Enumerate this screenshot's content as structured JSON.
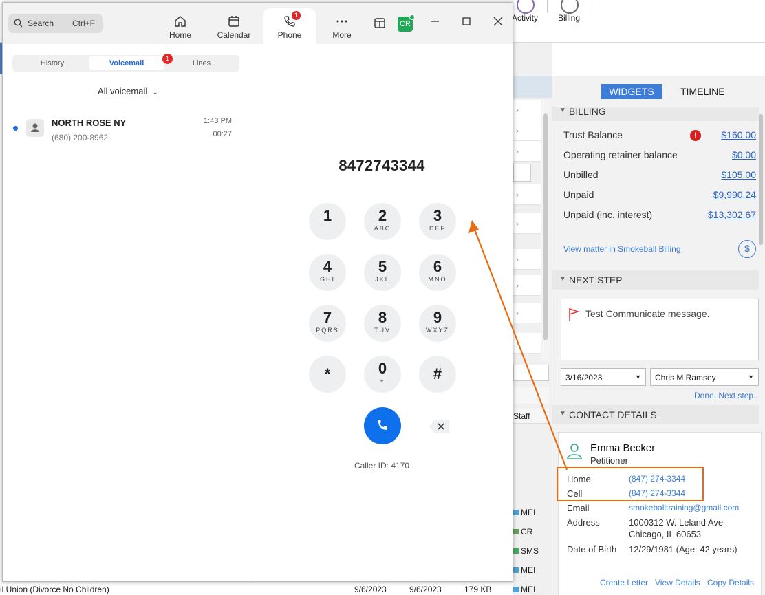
{
  "background_app": {
    "ribbon": {
      "activity_label": "Activity",
      "billing_label": "Billing"
    },
    "staff_header": "Staff",
    "tags": [
      "MEI",
      "CR",
      "SMS",
      "MEI",
      "MEI"
    ],
    "bottom_row": {
      "matter_type": "il Union (Divorce No Children)",
      "date1": "9/6/2023",
      "date2": "9/6/2023",
      "size": "179 KB"
    }
  },
  "side_panel": {
    "tabs": {
      "widgets": "WIDGETS",
      "timeline": "TIMELINE"
    },
    "billing": {
      "title": "BILLING",
      "rows": [
        {
          "label": "Trust Balance",
          "value": "$160.00",
          "warning": true
        },
        {
          "label": "Operating retainer balance",
          "value": "$0.00"
        },
        {
          "label": "Unbilled",
          "value": "$105.00"
        },
        {
          "label": "Unpaid",
          "value": "$9,990.24"
        },
        {
          "label": "Unpaid (inc. interest)",
          "value": "$13,302.67"
        }
      ],
      "view_link": "View matter in Smokeball Billing",
      "warning_glyph": "!",
      "dollar_glyph": "$"
    },
    "next_step": {
      "title": "NEXT STEP",
      "message": "Test Communicate message.",
      "date": "3/16/2023",
      "assignee": "Chris M Ramsey",
      "done_link": "Done. Next step..."
    },
    "contact_details": {
      "title": "CONTACT DETAILS",
      "name": "Emma Becker",
      "role": "Petitioner",
      "home_label": "Home",
      "home_value": "(847) 274-3344",
      "cell_label": "Cell",
      "cell_value": "(847) 274-3344",
      "email_label": "Email",
      "email_value": "smokeballtraining@gmail.com",
      "address_label": "Address",
      "address_line1": "1000312 W. Leland Ave",
      "address_line2": "Chicago, IL 60653",
      "dob_label": "Date of Birth",
      "dob_value": "12/29/1981 (Age: 42 years)",
      "actions": {
        "create_letter": "Create Letter",
        "view_details": "View Details",
        "copy_details": "Copy Details"
      }
    },
    "colors": {
      "accent": "#3b7dd8",
      "link": "#2a64c4",
      "highlight": "#e76d12",
      "warning": "#d81f1f"
    }
  },
  "zoom": {
    "search": {
      "placeholder": "Search",
      "shortcut": "Ctrl+F"
    },
    "nav": [
      {
        "label": "Home",
        "icon": "home-icon"
      },
      {
        "label": "Calendar",
        "icon": "calendar-icon"
      },
      {
        "label": "Phone",
        "icon": "phone-icon",
        "badge": "1",
        "active": true
      },
      {
        "label": "More",
        "icon": "more-icon"
      }
    ],
    "avatar_initials": "CR",
    "tabs": [
      {
        "label": "History"
      },
      {
        "label": "Voicemail",
        "active": true,
        "badge": "1"
      },
      {
        "label": "Lines"
      }
    ],
    "filter_label": "All voicemail",
    "voicemail": {
      "name": "NORTH ROSE NY",
      "number": "(680) 200-8962",
      "time": "1:43 PM",
      "duration": "00:27",
      "unread": true
    },
    "dialer": {
      "number": "8472743344",
      "keys": [
        {
          "digit": "1",
          "letters": ""
        },
        {
          "digit": "2",
          "letters": "ABC"
        },
        {
          "digit": "3",
          "letters": "DEF"
        },
        {
          "digit": "4",
          "letters": "GHI"
        },
        {
          "digit": "5",
          "letters": "JKL"
        },
        {
          "digit": "6",
          "letters": "MNO"
        },
        {
          "digit": "7",
          "letters": "PQRS"
        },
        {
          "digit": "8",
          "letters": "TUV"
        },
        {
          "digit": "9",
          "letters": "WXYZ"
        },
        {
          "digit": "*",
          "letters": ""
        },
        {
          "digit": "0",
          "letters": "+"
        },
        {
          "digit": "#",
          "letters": ""
        }
      ],
      "caller_id": "Caller ID: 4170"
    },
    "colors": {
      "call_button": "#0e71eb",
      "badge": "#e02828",
      "presence": "#23a656"
    }
  }
}
